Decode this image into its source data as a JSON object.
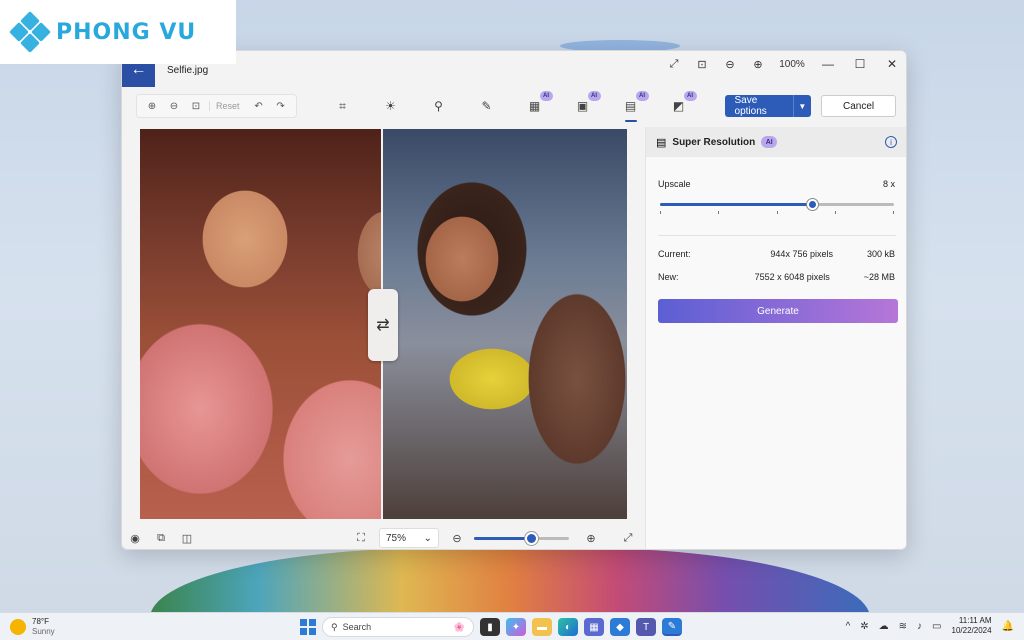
{
  "brand": {
    "logo_text": "PHONG VU"
  },
  "window": {
    "file_name": "Selfie.jpg",
    "back_icon": "arrow-left-icon",
    "zoom_level": "100%"
  },
  "toolbar": {
    "reset_label": "Reset",
    "save_label": "Save options",
    "cancel_label": "Cancel",
    "ai_badge": "AI",
    "tools": [
      {
        "name": "crop",
        "icon": "⌗",
        "ai": false,
        "active": false
      },
      {
        "name": "adjust",
        "icon": "☀",
        "ai": false,
        "active": false
      },
      {
        "name": "filter",
        "icon": "⚲",
        "ai": false,
        "active": false
      },
      {
        "name": "markup",
        "icon": "✎",
        "ai": false,
        "active": false
      },
      {
        "name": "generative-erase",
        "icon": "▦",
        "ai": true,
        "active": false
      },
      {
        "name": "background",
        "icon": "▣",
        "ai": true,
        "active": false
      },
      {
        "name": "super-resolution",
        "icon": "▤",
        "ai": true,
        "active": true
      },
      {
        "name": "restyle",
        "icon": "◩",
        "ai": true,
        "active": false
      }
    ]
  },
  "bottom": {
    "zoom_select": "75%",
    "zoom_slider_value": 0.6
  },
  "panel": {
    "title": "Super Resolution",
    "ai_badge": "AI",
    "upscale_label": "Upscale",
    "upscale_value": "8 x",
    "upscale_fraction": 0.65,
    "current_label": "Current:",
    "current_dims": "944x 756 pixels",
    "current_size": "300 kB",
    "new_label": "New:",
    "new_dims": "7552 x 6048 pixels",
    "new_size": "~28 MB",
    "generate_label": "Generate"
  },
  "taskbar": {
    "temperature": "78°F",
    "condition": "Sunny",
    "search_placeholder": "Search",
    "time": "11:11 AM",
    "date": "10/22/2024"
  },
  "colors": {
    "accent": "#2c5bb8",
    "title_accent": "#2c4fa6",
    "ai_badge": "#b9a7ee"
  }
}
